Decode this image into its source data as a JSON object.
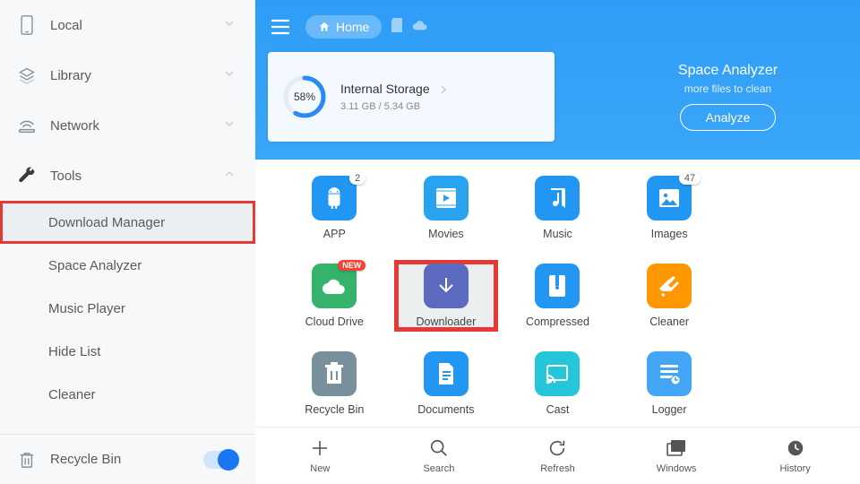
{
  "sidebar": {
    "items": [
      {
        "label": "Local"
      },
      {
        "label": "Library"
      },
      {
        "label": "Network"
      },
      {
        "label": "Tools"
      }
    ],
    "tools_sub": [
      {
        "label": "Download Manager"
      },
      {
        "label": "Space Analyzer"
      },
      {
        "label": "Music Player"
      },
      {
        "label": "Hide List"
      },
      {
        "label": "Cleaner"
      }
    ],
    "footer": {
      "label": "Recycle Bin"
    }
  },
  "header": {
    "home_label": "Home",
    "storage": {
      "percent": "58%",
      "title": "Internal Storage",
      "sub": "3.11 GB / 5.34 GB"
    },
    "analyzer": {
      "title": "Space Analyzer",
      "sub": "more files to clean",
      "btn": "Analyze"
    }
  },
  "grid": [
    {
      "label": "APP",
      "color": "#2196f3",
      "badge": "2"
    },
    {
      "label": "Movies",
      "color": "#29a3f0"
    },
    {
      "label": "Music",
      "color": "#2196f3"
    },
    {
      "label": "Images",
      "color": "#2196f3",
      "badge": "47"
    },
    {
      "label": "Cloud Drive",
      "color": "#35b36a",
      "badge_new": "NEW"
    },
    {
      "label": "Downloader",
      "color": "#5c6bc0"
    },
    {
      "label": "Compressed",
      "color": "#2196f3"
    },
    {
      "label": "Cleaner",
      "color": "#ff9800"
    },
    {
      "label": "Recycle Bin",
      "color": "#78909c"
    },
    {
      "label": "Documents",
      "color": "#2196f3"
    },
    {
      "label": "Cast",
      "color": "#26c6da"
    },
    {
      "label": "Logger",
      "color": "#42a5f5"
    }
  ],
  "bottom": [
    {
      "label": "New"
    },
    {
      "label": "Search"
    },
    {
      "label": "Refresh"
    },
    {
      "label": "Windows"
    },
    {
      "label": "History"
    }
  ]
}
